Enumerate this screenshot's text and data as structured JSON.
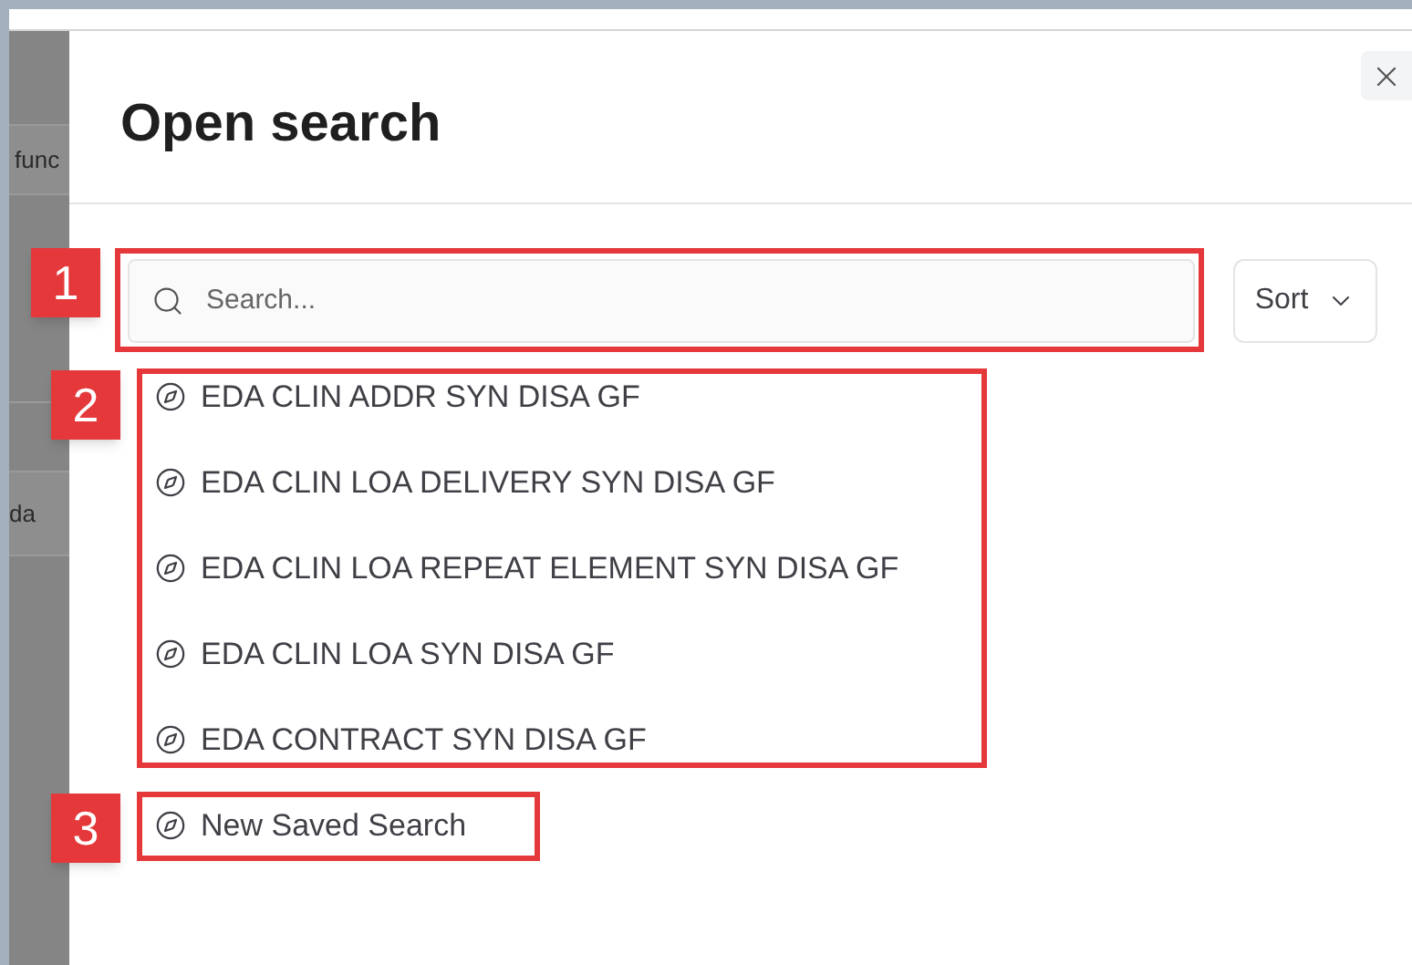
{
  "background": {
    "texts": [
      "func",
      "da"
    ]
  },
  "dialog": {
    "title": "Open search",
    "search": {
      "placeholder": "Search...",
      "annotation": "1"
    },
    "sort": {
      "label": "Sort"
    },
    "saved_list": {
      "annotation": "2",
      "items": [
        {
          "label": "EDA CLIN ADDR SYN DISA GF"
        },
        {
          "label": "EDA CLIN LOA DELIVERY SYN DISA GF"
        },
        {
          "label": "EDA CLIN LOA REPEAT ELEMENT SYN DISA GF"
        },
        {
          "label": "EDA CLIN LOA SYN DISA GF"
        },
        {
          "label": "EDA CONTRACT SYN DISA GF"
        }
      ]
    },
    "new_search": {
      "label": "New Saved Search",
      "annotation": "3"
    }
  }
}
